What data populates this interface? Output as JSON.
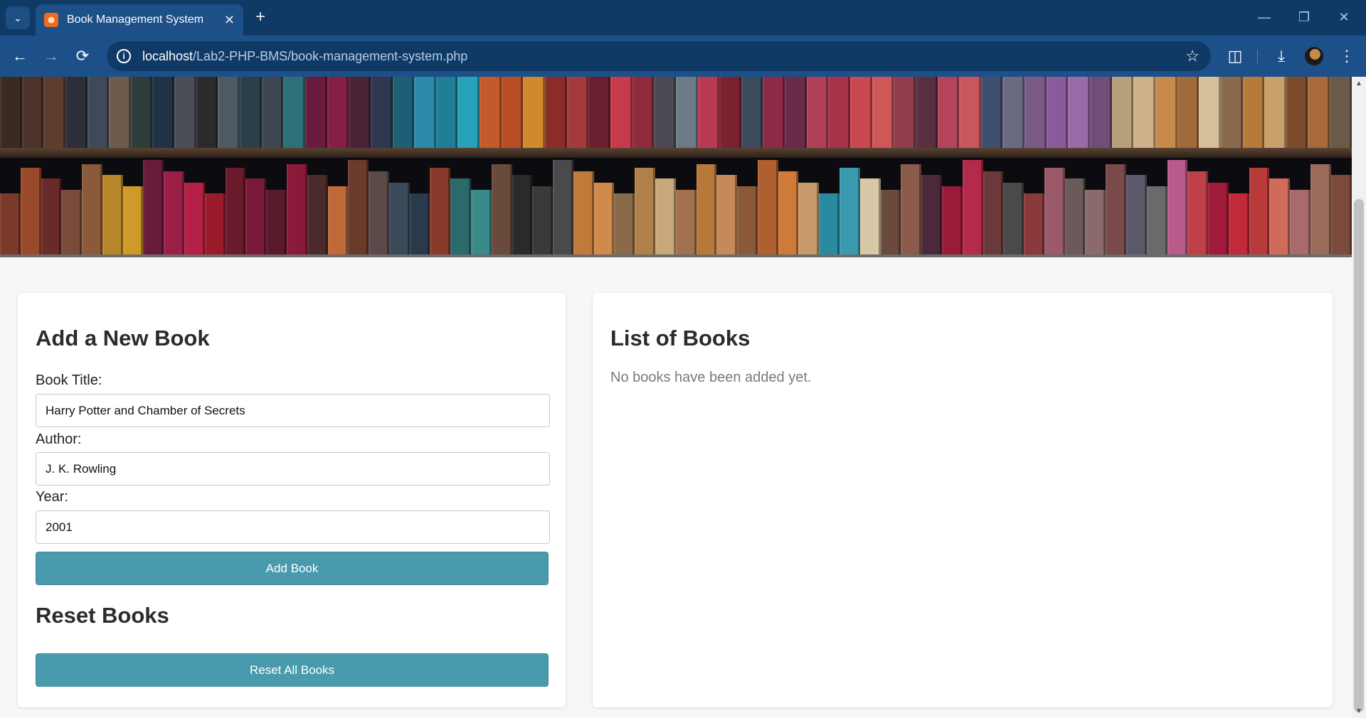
{
  "browser": {
    "tab_title": "Book Management System",
    "url_host": "localhost",
    "url_path": "/Lab2-PHP-BMS/book-management-system.php",
    "icons": [
      "tab-search-icon",
      "new-tab-icon",
      "minimize-icon",
      "restore-icon",
      "close-window-icon",
      "back-icon",
      "forward-icon",
      "reload-icon",
      "site-info-icon",
      "bookmark-star-icon",
      "extensions-icon",
      "download-icon",
      "profile-avatar",
      "menu-icon"
    ]
  },
  "banner": {
    "image": "bookshelf-banner",
    "top_shelf_colors": [
      "#3b2a22",
      "#4a3329",
      "#5c3d2e",
      "#2c2f3a",
      "#40495a",
      "#6d5a4b",
      "#2e3d3b",
      "#223246",
      "#4b4e57",
      "#2b2b2b",
      "#4f5962",
      "#2a3f47",
      "#3d4750",
      "#2e6f78",
      "#6a1a3a",
      "#842046",
      "#4a2436",
      "#2f3850",
      "#1f5f75",
      "#2a8aa8",
      "#1e7f96",
      "#27a1b8",
      "#c25a2a",
      "#b84e26",
      "#d08a2e",
      "#8b2c2b",
      "#a43a3e",
      "#6b1f2e",
      "#c63b4b",
      "#8f2c3c",
      "#4a4a55",
      "#6d7b86",
      "#b83a52",
      "#7a2230",
      "#3b4a5c",
      "#8d2a45",
      "#6a2a49",
      "#b04058",
      "#a8324a",
      "#c9494f",
      "#d05757",
      "#8f3c4c",
      "#5a2f42",
      "#b3445a",
      "#c8565e",
      "#3e4f70",
      "#6a6a80",
      "#7a5b86",
      "#8b5a9a",
      "#9b6aa8",
      "#6f4f78",
      "#b8a17a",
      "#cfb28a",
      "#c78a4a",
      "#a06a3a",
      "#d6c09a",
      "#8a6a4a",
      "#b87a3a",
      "#caa06a",
      "#7a4a2a",
      "#a86a3a",
      "#6a5a4a"
    ],
    "bottom_shelf_colors": [
      "#7a3a2a",
      "#9a4a2a",
      "#6a2a2a",
      "#7a4a3a",
      "#8a5a3a",
      "#b8862a",
      "#d09a2a",
      "#6a1a3a",
      "#9a1f45",
      "#b52048",
      "#9a1c2a",
      "#6a1a2a",
      "#7a1a3a",
      "#5a1a2a",
      "#8a1a3a",
      "#4a2a2a",
      "#c06a3a",
      "#6a3a2a",
      "#5a4a4a",
      "#3a4a5a",
      "#2a3a4a",
      "#8a3a2a",
      "#2a6a6a",
      "#3a8a8a",
      "#6a4a3a",
      "#2a2a2a",
      "#3a3a3a",
      "#4a4a4a",
      "#c07a3a",
      "#d08a4a",
      "#8a6a4a",
      "#b0804a",
      "#c8a87a",
      "#a07050",
      "#b8783a",
      "#c48a5a",
      "#8a5a3a",
      "#b06030",
      "#d07a3a",
      "#c89a6a",
      "#2a8aa0",
      "#3a9ab0",
      "#d8c8a8",
      "#6a4a3a",
      "#8a5a4a",
      "#4a2a3a",
      "#9a1a3a",
      "#b42a4a",
      "#6a3a3a",
      "#4a4a4a",
      "#8a3a3a",
      "#9a5a6a",
      "#6a5a5a",
      "#8a6a6a",
      "#7a4a4a",
      "#5a5a6a",
      "#6a6a6a",
      "#b85a8a",
      "#c0404a",
      "#a01a3a",
      "#c02a3a",
      "#b83a3a",
      "#d06a5a",
      "#a86a6a",
      "#9a6a5a",
      "#7a4a3a"
    ]
  },
  "form": {
    "heading": "Add a New Book",
    "title_label": "Book Title:",
    "title_value": "Harry Potter and Chamber of Secrets",
    "author_label": "Author:",
    "author_value": "J. K. Rowling",
    "year_label": "Year:",
    "year_value": "2001",
    "add_button": "Add Book"
  },
  "reset": {
    "heading": "Reset Books",
    "reset_button": "Reset All Books"
  },
  "list": {
    "heading": "List of Books",
    "empty_message": "No books have been added yet."
  },
  "colors": {
    "chrome_dark": "#0f3a66",
    "chrome_toolbar": "#1d5088",
    "button_accent": "#4a9aad",
    "page_bg": "#f7f7f7"
  }
}
